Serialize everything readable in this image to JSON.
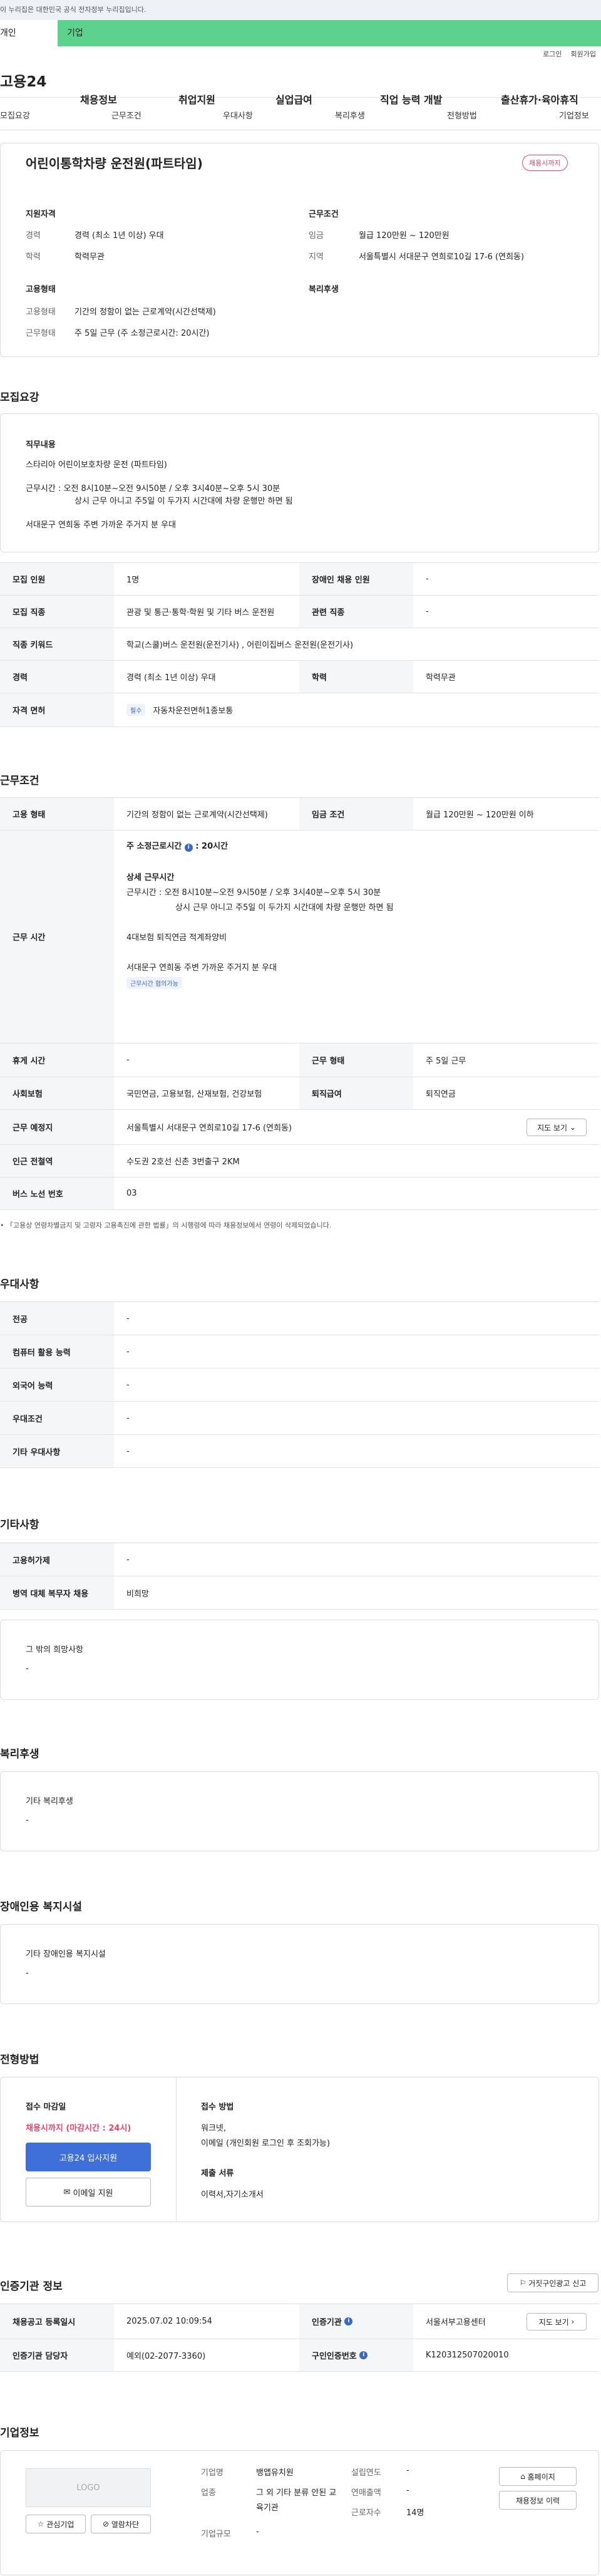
{
  "gov_banner": "이 누리집은 대한민국 공식 전자정부 누리집입니다.",
  "persona_tabs": [
    "개인",
    "기업"
  ],
  "util_links": [
    "로그인",
    "회원가입"
  ],
  "brand": "고용24",
  "gnb": [
    "채용정보",
    "취업지원",
    "실업급여",
    "직업 능력 개발",
    "출산휴가·육아휴직"
  ],
  "page_tabs": [
    "모집요강",
    "근무조건",
    "우대사항",
    "복리후생",
    "전형방법",
    "기업정보"
  ],
  "job": {
    "title": "어린이통학차량 운전원(파트타임)",
    "status": "채용시까지",
    "qual_h": "지원자격",
    "work_h": "근무조건",
    "emp_h": "고용형태",
    "welfare_h": "복리후생",
    "qual": [
      [
        "경력",
        "경력 (최소 1년 이상) 우대"
      ],
      [
        "학력",
        "학력무관"
      ]
    ],
    "work": [
      [
        "임금",
        "월급 120만원 ~ 120만원"
      ],
      [
        "지역",
        "서울특별시 서대문구 연희로10길 17-6 (연희동)"
      ]
    ],
    "emp": [
      [
        "고용형태",
        "기간의 정함이 없는 근로계약(시간선택제)"
      ],
      [
        "근무형태",
        "주 5일 근무 (주 소정근로시간: 20시간)"
      ]
    ]
  },
  "recruit": {
    "heading": "모집요강",
    "duty_h": "직무내용",
    "duty_lines": [
      "스타리아 어린이보호차량 운전 (파트타임)",
      "근무시간 : 오전 8시10분~오전 9시50분 / 오후 3시40분~오후 5시 30분",
      "상시 근무 아니고 주5일 이 두가지 시간대에 차량 운행만 하면 됨",
      "서대문구 연희동 주변 가까운 주거지 분 우대"
    ],
    "rows": [
      {
        "k1": "모집 인원",
        "v1": "1명",
        "k2": "장애인 채용 인원",
        "v2": "-"
      },
      {
        "k1": "모집 직종",
        "v1": "관광 및 통근·통학·학원 및 기타 버스 운전원",
        "k2": "관련 직종",
        "v2": "-"
      },
      {
        "k1": "직종 키워드",
        "v1": "학교(스쿨)버스 운전원(운전기사) , 어린이집버스 운전원(운전기사)"
      },
      {
        "k1": "경력",
        "v1": "경력 (최소 1년 이상) 우대",
        "k2": "학력",
        "v2": "학력무관"
      },
      {
        "k1": "자격 면허",
        "badge": "필수",
        "v1": "자동차운전면허1종보통"
      }
    ]
  },
  "conditions": {
    "heading": "근무조건",
    "r1": {
      "k1": "고용 형태",
      "v1": "기간의 정함이 없는 근로계약(시간선택제)",
      "k2": "임금 조건",
      "v2": "월급 120만원 ~ 120만원 이하"
    },
    "hours_k": "근무 시간",
    "hours_bold": "주 소정근로시간",
    "hours_val": ": 20시간",
    "detail_h": "상세 근무시간",
    "detail_lines": [
      "근무시간 : 오전 8시10분~오전 9시50분 / 오후 3시40분~오후 5시 30분",
      "상시 근무 아니고 주5일 이 두가지 시간대에 차량 운행만 하면 됨",
      "4대보험 퇴직연금 적계좌양비",
      "서대문구 연희동 주변 가까운 주거지 분 우대"
    ],
    "tag": "근무시간 협의가능",
    "rows": [
      {
        "k1": "휴게 시간",
        "v1": "-",
        "k2": "근무 형태",
        "v2": "주 5일 근무"
      },
      {
        "k1": "사회보험",
        "v1": "국민연금, 고용보험, 산재보험, 건강보험",
        "k2": "퇴직급여",
        "v2": "퇴직연금"
      }
    ],
    "place_k": "근무 예정지",
    "place_v": "서울특별시 서대문구 연희로10길 17-6 (연희동)",
    "map_btn": "지도 보기",
    "station_k": "인근 전철역",
    "station_v": "수도권 2호선 신촌 3번출구 2KM",
    "bus_k": "버스 노선 번호",
    "bus_v": "03",
    "note": "「고용상 연령차별금지 및 고령자 고용촉진에 관한 법률」의 시행령에 따라 채용정보에서 연령이 삭제되었습니다."
  },
  "prefer": {
    "heading": "우대사항",
    "rows": [
      [
        "전공",
        "-"
      ],
      [
        "컴퓨터 활용 능력",
        "-"
      ],
      [
        "외국어 능력",
        "-"
      ],
      [
        "우대조건",
        "-"
      ],
      [
        "기타 우대사항",
        "-"
      ]
    ]
  },
  "other": {
    "heading": "기타사항",
    "rows": [
      [
        "고용허가제",
        "-"
      ],
      [
        "병역 대체 복무자 채용",
        "비희망"
      ]
    ],
    "box_h": "그 밖의 희망사항",
    "box_v": "-"
  },
  "benefits": {
    "heading": "복리후생",
    "box_h": "기타 복리후생",
    "box_v": "-"
  },
  "disability": {
    "heading": "장애인용 복지시설",
    "box_h": "기타 장애인용 복지시설",
    "box_v": "-"
  },
  "process": {
    "heading": "전형방법",
    "deadline_h": "접수 마감일",
    "deadline_v": "채용시까지 (마감시간 : 24시)",
    "apply_btn": "고용24 입사지원",
    "email_btn": "이메일 지원",
    "method_h": "접수 방법",
    "method_v1": "워크넷,",
    "method_v2": "이메일 (개인회원 로그인 후 조회가능)",
    "docs_h": "제출 서류",
    "docs_v": "이력서,자기소개서"
  },
  "agency": {
    "heading": "인증기관 정보",
    "report_btn": "거짓구인광고 신고",
    "rows": [
      {
        "k1": "채용공고 등록일시",
        "v1": "2025.07.02 10:09:54",
        "k2": "인증기관",
        "v2": "서울서부고용센터",
        "btn": "지도 보기"
      },
      {
        "k1": "인증기관 담당자",
        "v1": "예외(02-2077-3360)",
        "k2": "구인인증번호",
        "v2": "K120312507020010"
      }
    ]
  },
  "company": {
    "heading": "기업정보",
    "logo": "LOGO",
    "fav_btn": "관심기업",
    "block_btn": "열람차단",
    "homepage_btn": "홈페이지",
    "jobs_btn": "채용정보 이력",
    "f": [
      [
        "기업명",
        "뱅앱유치원"
      ],
      [
        "업종",
        "그 외 기타 분류 안된 교육기관"
      ],
      [
        "기업규모",
        "-"
      ],
      [
        "설립연도",
        "-"
      ],
      [
        "연매출액",
        "-"
      ],
      [
        "근로자수",
        "14명"
      ]
    ]
  }
}
